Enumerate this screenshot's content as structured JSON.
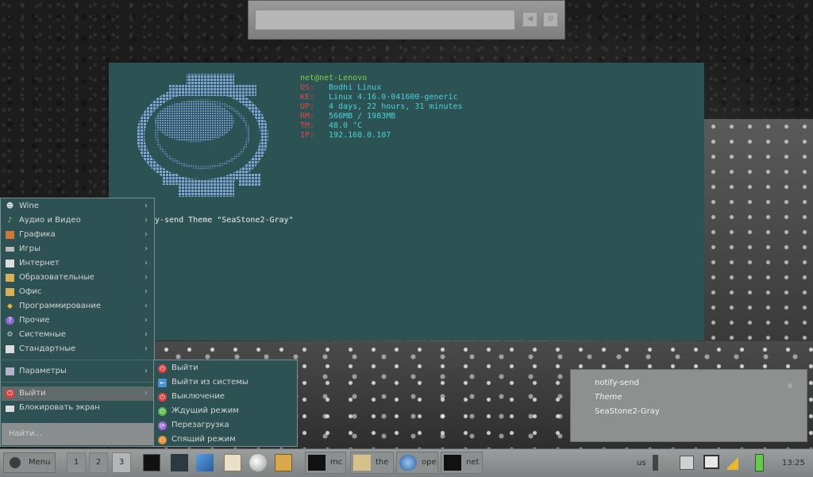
{
  "terminal": {
    "userhost": "net@net-Lenovo",
    "info": [
      {
        "key": "OS:",
        "value": "Bodhi Linux"
      },
      {
        "key": "KE:",
        "value": "Linux 4.16.0-041600-generic"
      },
      {
        "key": "UP:",
        "value": "4 days, 22 hours, 31 minutes"
      },
      {
        "key": "RM:",
        "value": "566MB / 1983MB"
      },
      {
        "key": "TM:",
        "value": "48.0 °C"
      },
      {
        "key": "IP:",
        "value": "192.168.0.107"
      }
    ],
    "command_tail": "y-send Theme \"SeaStone2-Gray\""
  },
  "menu": {
    "items": [
      {
        "label": "Wine",
        "icon": "wine-icon"
      },
      {
        "label": "Аудио и Видео",
        "icon": "music-note-icon"
      },
      {
        "label": "Графика",
        "icon": "graphics-icon"
      },
      {
        "label": "Игры",
        "icon": "gamepad-icon"
      },
      {
        "label": "Интернет",
        "icon": "internet-icon"
      },
      {
        "label": "Образовательные",
        "icon": "folder-icon"
      },
      {
        "label": "Офис",
        "icon": "folder-icon"
      },
      {
        "label": "Программирование",
        "icon": "diamond-icon"
      },
      {
        "label": "Прочие",
        "icon": "question-icon"
      },
      {
        "label": "Системные",
        "icon": "gear-icon"
      },
      {
        "label": "Стандартные",
        "icon": "document-icon"
      }
    ],
    "settings": "Параметры",
    "logout": "Выйти",
    "lock": "Блокировать экран",
    "search_placeholder": "Найти..."
  },
  "submenu": {
    "items": [
      {
        "label": "Выйти",
        "color": "#e04040"
      },
      {
        "label": "Выйти из системы",
        "color": "#4a90d9"
      },
      {
        "label": "Выключение",
        "color": "#e04040"
      },
      {
        "label": "Ждущий режим",
        "color": "#5ab54a"
      },
      {
        "label": "Перезагрузка",
        "color": "#9a6ad6"
      },
      {
        "label": "Спящий режим",
        "color": "#e08a30"
      }
    ]
  },
  "notification": {
    "app": "notify-send",
    "summary": "Theme",
    "body": "SeaStone2-Gray"
  },
  "taskbar": {
    "menu_label": "Menu",
    "workspaces": [
      "1",
      "2",
      "3"
    ],
    "tasks": [
      {
        "label": "mc"
      },
      {
        "label": "the"
      },
      {
        "label": "ope"
      },
      {
        "label": "net"
      }
    ],
    "keyboard_layout": "us",
    "clock": "13:25"
  }
}
